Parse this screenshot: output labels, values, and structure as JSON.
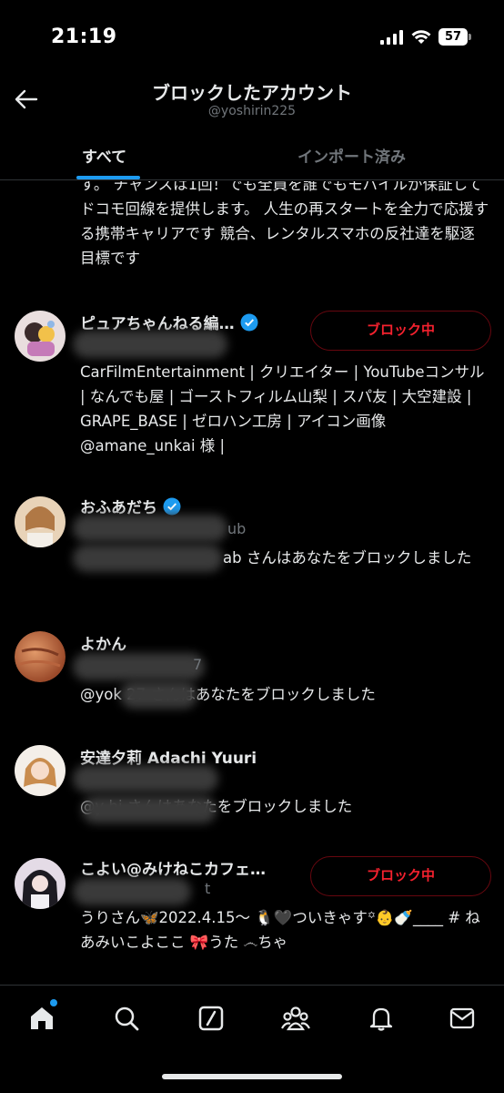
{
  "status": {
    "time": "21:19",
    "battery": "57"
  },
  "header": {
    "title": "ブロックしたアカウント",
    "subtitle": "@yoshirin225"
  },
  "tabs": [
    {
      "label": "すべて"
    },
    {
      "label": "インポート済み"
    }
  ],
  "truncated_bio": "す。 チャンスは1回！でも全員を誰でもモバイルが保証してドコモ回線を提供します。 人生の再スタートを全力で応援する携帯キャリアです 競合、レンタルスマホの反社達を駆逐目標です",
  "accounts": [
    {
      "name": "ピュアちゃんねる編…",
      "handle": "",
      "bio": "CarFilmEntertainment | クリエイター | YouTubeコンサル | なんでも屋 | ゴーストフィルム山梨 | スパ友 | 大空建設 | GRAPE_BASE | ゼロハン工房 | アイコン画像 @amane_unkai 様 |",
      "button": "ブロック中"
    },
    {
      "name": "おふあだち",
      "handle": "ub",
      "bio": "ab さんはあなたをブロックしました"
    },
    {
      "name": "よかん",
      "handle": "7",
      "bio": "@yok 27 さんはあなたをブロックしました"
    },
    {
      "name": "安達夕莉 Adachi Yuuri",
      "handle": "",
      "bio": "@y hi さんはあなたをブロックしました"
    },
    {
      "name": "こよい@みけねこカフェ…",
      "handle": "t",
      "bio": "うりさん🦋2022.4.15〜 🐧🖤ついきゃす꙳👶🍼____ # ねあみいこよここ 🎀うた ෴ちゃ",
      "button": "ブロック中"
    }
  ],
  "nav": [
    "home-icon",
    "search-icon",
    "grok-icon",
    "communities-icon",
    "notifications-icon",
    "messages-icon"
  ],
  "colors": {
    "accent": "#1d9bf0",
    "danger": "#f4212e",
    "background": "#000000"
  }
}
